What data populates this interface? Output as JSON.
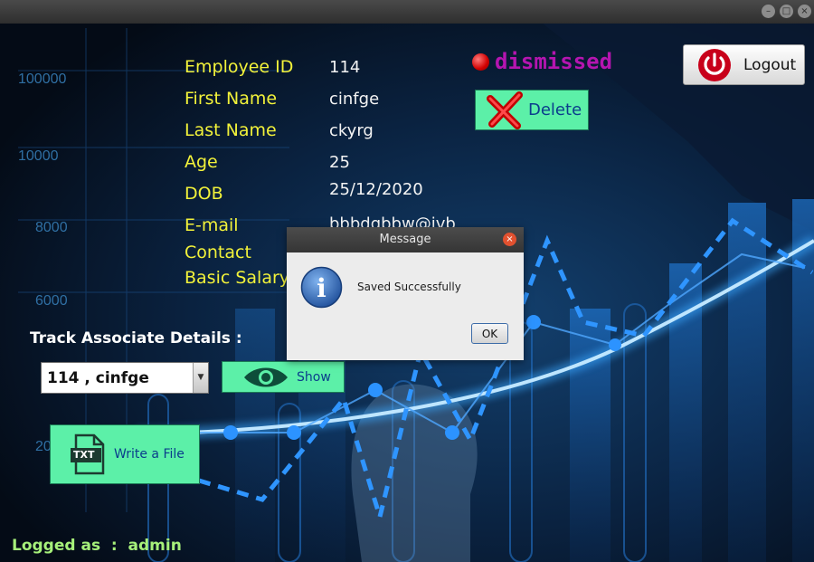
{
  "window": {
    "controls": {
      "minimize": "–",
      "maximize": "□",
      "close": "×"
    }
  },
  "chart_axis_labels": [
    "100000",
    "10000",
    "8000",
    "6000",
    "20"
  ],
  "employee": {
    "fields": [
      {
        "label": "Employee ID",
        "value": "114"
      },
      {
        "label": "First Name",
        "value": "cinfge"
      },
      {
        "label": "Last Name",
        "value": "ckyrg"
      },
      {
        "label": "Age",
        "value": "25"
      },
      {
        "label": "DOB",
        "value": "25/12/2020"
      },
      {
        "label": "E-mail",
        "value": "bbbdgbbw@ivb"
      },
      {
        "label": "Contact",
        "value": ""
      },
      {
        "label": "Basic Salary",
        "value": ""
      }
    ]
  },
  "status": {
    "text": "dismissed",
    "color": "#b515b0",
    "dot_color": "#d10000"
  },
  "buttons": {
    "delete": "Delete",
    "logout": "Logout",
    "show": "Show",
    "write_file": "Write a File",
    "txt_icon_text": "TXT"
  },
  "track": {
    "label": "Track Associate Details :",
    "selected": "114 , cinfge"
  },
  "footer": {
    "logged_as": "Logged as  :  admin"
  },
  "dialog": {
    "title": "Message",
    "message": "Saved Successfully",
    "ok": "OK",
    "info_glyph": "i",
    "close_glyph": "×"
  },
  "colors": {
    "label_yellow": "#f2f23a",
    "button_green": "#5cf0a8",
    "footer_green": "#a6f07a"
  }
}
